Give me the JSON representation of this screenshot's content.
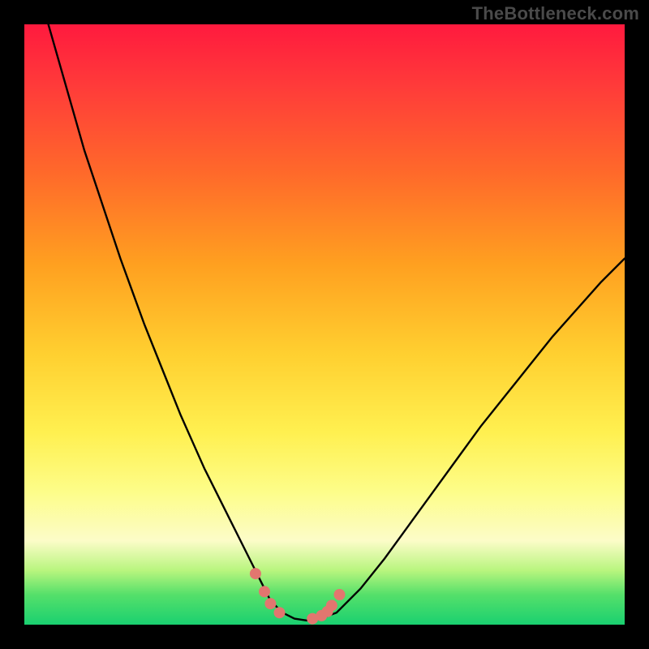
{
  "watermark": "TheBottleneck.com",
  "colors": {
    "background": "#000000",
    "curve": "#000000",
    "marker": "#e2766f",
    "gradient_stops": [
      "#ff1a3e",
      "#ff3a3a",
      "#ff6a2a",
      "#ffa020",
      "#ffd030",
      "#fff050",
      "#fdfd8a",
      "#fcfcc8",
      "#b8f57e",
      "#55e06a",
      "#1ad070"
    ]
  },
  "chart_data": {
    "type": "line",
    "title": "",
    "xlabel": "",
    "ylabel": "",
    "xlim": [
      0,
      100
    ],
    "ylim": [
      0,
      100
    ],
    "series": [
      {
        "name": "bottleneck-curve",
        "x": [
          4,
          6,
          8,
          10,
          12,
          14,
          16,
          18,
          20,
          22,
          24,
          26,
          28,
          30,
          32,
          34,
          36,
          38,
          39.5,
          41,
          43,
          45,
          47,
          49,
          52,
          56,
          60,
          64,
          68,
          72,
          76,
          80,
          84,
          88,
          92,
          96,
          100
        ],
        "y": [
          100,
          93,
          86,
          79,
          73,
          67,
          61,
          55.5,
          50,
          45,
          40,
          35,
          30.5,
          26,
          22,
          18,
          14,
          10,
          7,
          4,
          2,
          1,
          0.7,
          0.9,
          2,
          6,
          11,
          16.5,
          22,
          27.5,
          33,
          38,
          43,
          48,
          52.5,
          57,
          61
        ]
      }
    ],
    "markers": {
      "name": "highlight-dots",
      "x": [
        38.5,
        40,
        41,
        42.5,
        48,
        49.5,
        50.5,
        51.2,
        52.5
      ],
      "y": [
        8.5,
        5.5,
        3.5,
        2,
        1,
        1.5,
        2.2,
        3.2,
        5
      ]
    }
  }
}
